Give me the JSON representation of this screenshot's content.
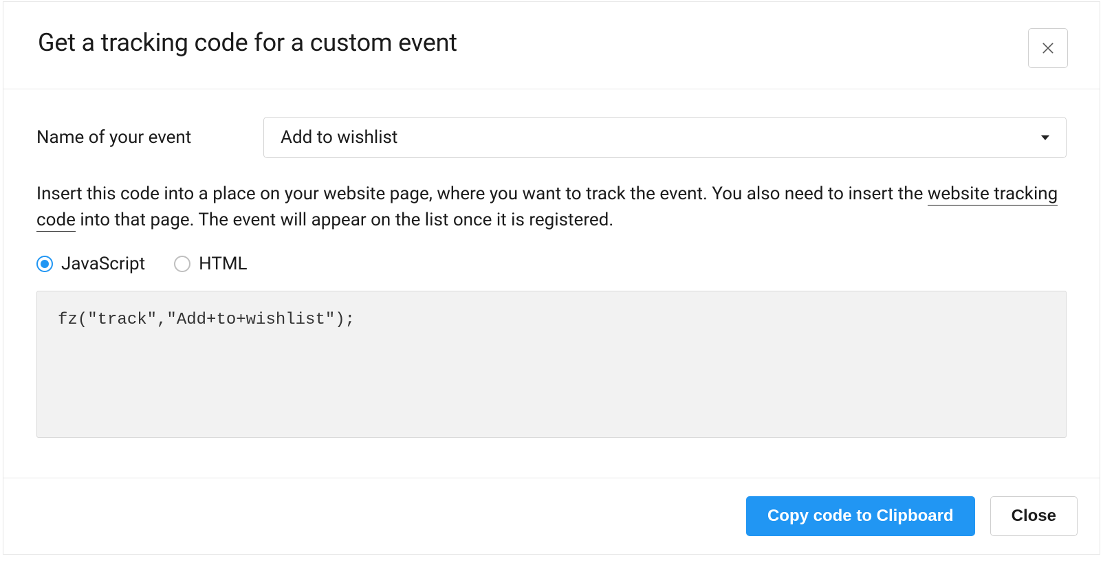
{
  "dialog": {
    "title": "Get a tracking code for a custom event",
    "event_name_label": "Name of your event",
    "event_name_value": "Add to wishlist",
    "instructions_pre": "Insert this code into a place on your website page, where you want to track the event. You also need to insert the ",
    "instructions_link": "website tracking code",
    "instructions_post": " into that page. The event will appear on the list once it is registered.",
    "radio": {
      "javascript": "JavaScript",
      "html": "HTML",
      "selected": "javascript"
    },
    "code_snippet": "fz(\"track\",\"Add+to+wishlist\");",
    "footer": {
      "copy_button": "Copy code to Clipboard",
      "close_button": "Close"
    }
  }
}
